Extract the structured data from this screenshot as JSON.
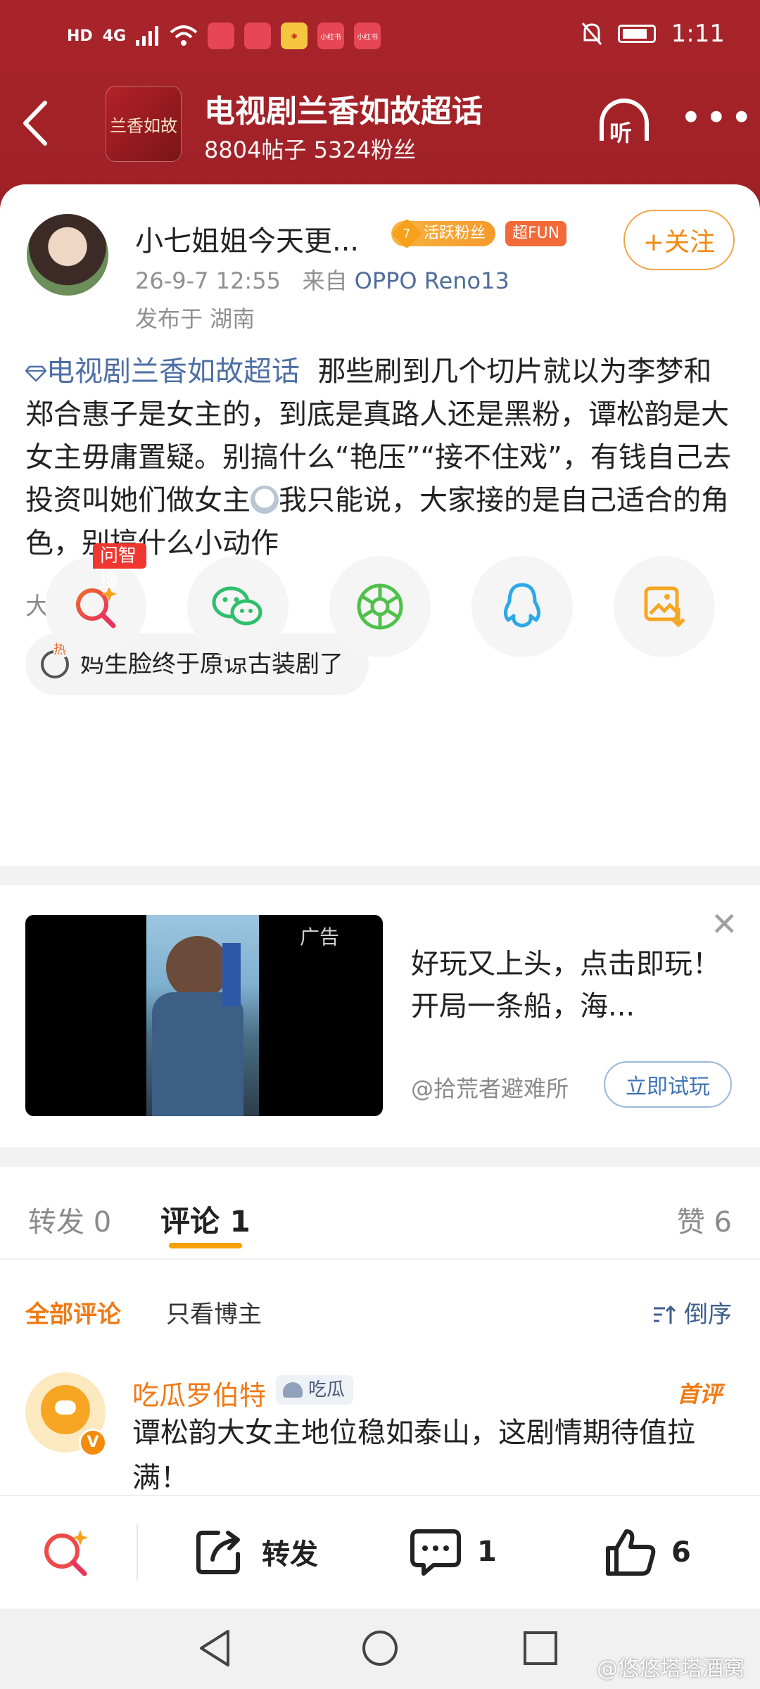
{
  "status_bar": {
    "network": "4G",
    "mini_apps": [
      "",
      "",
      "",
      "小红书",
      "小红书"
    ],
    "time": "1:11"
  },
  "header": {
    "topic_thumb_text": "兰香如故",
    "title": "电视剧兰香如故超话",
    "stats": "8804帖子 5324粉丝",
    "listen_label": "听"
  },
  "post": {
    "username": "小七姐姐今天更...",
    "fan_level": "7",
    "fan_badge": "活跃粉丝",
    "fun_badge": "超FUN",
    "follow_label": "+关注",
    "time": "26-9-7 12:55",
    "from_prefix": "来自",
    "device": "OPPO Reno13",
    "location": "发布于 湖南",
    "topic_tag": "电视剧兰香如故超话",
    "body_text": "那些刷到几个切片就以为李梦和郑合惠子是女主的，到底是真路人还是黑粉，谭松韵是大女主毋庸置疑。别搞什么“艳压”“接不住戏”，有钱自己去投资叫她们做女主",
    "body_text_2": "我只能说，大家接的是自己适合的角色，别搞什么小动作"
  },
  "search": {
    "label": "大家都在搜",
    "hot_query": "妈生脸终于原谅古装剧了",
    "hot_mark": "热"
  },
  "share": {
    "ai_search_tag": "问智搜"
  },
  "ad": {
    "tag": "广告",
    "text": "好玩又上头，点击即玩！开局一条船，海...",
    "source": "@拾荒者避难所",
    "cta": "立即试玩",
    "close": "✕"
  },
  "tabs": {
    "repost": "转发 0",
    "comments": "评论 1",
    "likes": "赞 6"
  },
  "filters": {
    "all": "全部评论",
    "host_only": "只看博主",
    "sort": "倒序"
  },
  "comment": {
    "name": "吃瓜罗伯特",
    "badge": "吃瓜",
    "first_label": "首评",
    "text": "谭松韵大女主地位稳如泰山，这剧情期待值拉满！",
    "vip": "V"
  },
  "actions": {
    "repost": "转发",
    "comment_count": "1",
    "like_count": "6"
  },
  "watermark": "@悠悠塔塔酒窝",
  "colors": {
    "header_red": "#a8242a",
    "accent_orange": "#f07a14",
    "link_blue": "#4e6fa5"
  }
}
